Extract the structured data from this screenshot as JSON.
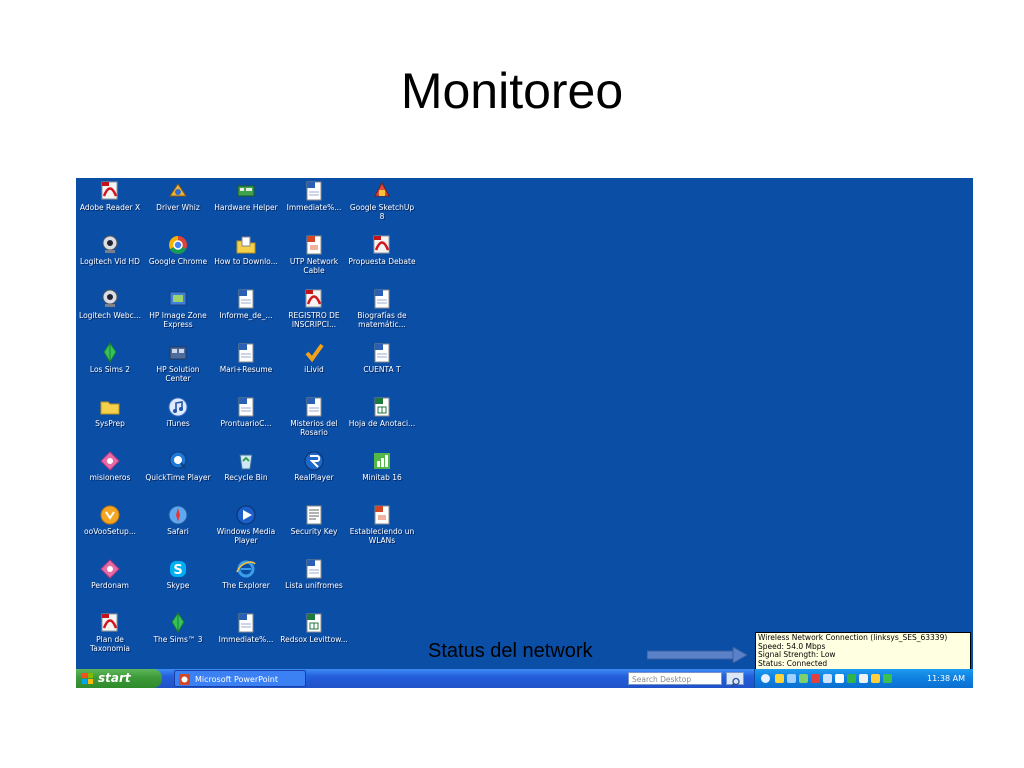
{
  "slide": {
    "title": "Monitoreo"
  },
  "desktop": {
    "background_color": "#0b4ea6",
    "columns": [
      [
        {
          "label": "Adobe Reader X",
          "icon": "pdf-icon"
        },
        {
          "label": "Logitech Vid HD",
          "icon": "webcam-icon"
        },
        {
          "label": "Logitech Webc...",
          "icon": "webcam-icon"
        },
        {
          "label": "Los Sims 2",
          "icon": "plumbob-icon"
        },
        {
          "label": "SysPrep",
          "icon": "folder-icon"
        },
        {
          "label": "misioneros",
          "icon": "network-star-icon"
        },
        {
          "label": "ooVooSetup...",
          "icon": "oovoo-icon"
        },
        {
          "label": "Perdonam",
          "icon": "network-star-icon"
        },
        {
          "label": "Plan de Taxonomia",
          "icon": "pdf-icon"
        }
      ],
      [
        {
          "label": "Driver Whiz",
          "icon": "driver-icon"
        },
        {
          "label": "Google Chrome",
          "icon": "chrome-icon"
        },
        {
          "label": "HP Image Zone Express",
          "icon": "hp-image-icon"
        },
        {
          "label": "HP Solution Center",
          "icon": "hp-solution-icon"
        },
        {
          "label": "iTunes",
          "icon": "music-icon"
        },
        {
          "label": "QuickTime Player",
          "icon": "quicktime-icon"
        },
        {
          "label": "Safari",
          "icon": "compass-icon"
        },
        {
          "label": "Skype",
          "icon": "skype-icon"
        },
        {
          "label": "The Sims™ 3",
          "icon": "plumbob-icon"
        }
      ],
      [
        {
          "label": "Hardware Helper",
          "icon": "hardware-icon"
        },
        {
          "label": "How to Downlo...",
          "icon": "folder-doc-icon"
        },
        {
          "label": "Informe_de_...",
          "icon": "word-doc-icon"
        },
        {
          "label": "Mari+Resume",
          "icon": "word-doc-icon"
        },
        {
          "label": "ProntuarioC...",
          "icon": "word-doc-icon"
        },
        {
          "label": "Recycle Bin",
          "icon": "recycle-bin-icon"
        },
        {
          "label": "Windows Media Player",
          "icon": "media-player-icon"
        },
        {
          "label": "The Explorer",
          "icon": "ie-icon"
        },
        {
          "label": "Immediate%...",
          "icon": "word-doc-icon"
        }
      ],
      [
        {
          "label": "Immediate%...",
          "icon": "word-doc-icon"
        },
        {
          "label": "UTP Network Cable",
          "icon": "ppt-doc-icon"
        },
        {
          "label": "REGISTRO DE INSCRIPCI...",
          "icon": "pdf-icon"
        },
        {
          "label": "iLivid",
          "icon": "ilivid-icon"
        },
        {
          "label": "Misterios del Rosario",
          "icon": "word-doc-icon"
        },
        {
          "label": "RealPlayer",
          "icon": "realplayer-icon"
        },
        {
          "label": "Security Key",
          "icon": "text-doc-icon"
        },
        {
          "label": "Lista unifromes",
          "icon": "word-doc-icon"
        },
        {
          "label": "Redsox Levittow...",
          "icon": "excel-doc-icon"
        }
      ],
      [
        {
          "label": "Google SketchUp 8",
          "icon": "sketchup-icon"
        },
        {
          "label": "Propuesta Debate",
          "icon": "pdf-icon"
        },
        {
          "label": "Biografías de matemátic...",
          "icon": "word-doc-icon"
        },
        {
          "label": "CUENTA T",
          "icon": "word-doc-icon"
        },
        {
          "label": "Hoja de Anotaci...",
          "icon": "excel-doc-icon"
        },
        {
          "label": "Minitab 16",
          "icon": "minitab-icon"
        },
        {
          "label": "Estableciendo un WLANs",
          "icon": "ppt-doc-icon"
        }
      ]
    ]
  },
  "annotation": {
    "text": "Status del network",
    "arrow_icon": "right-arrow-icon"
  },
  "tooltip": {
    "lines": [
      "Wireless Network Connection (linksys_SES_63339)",
      "Speed: 54.0 Mbps",
      "Signal Strength: Low",
      "Status: Connected"
    ]
  },
  "taskbar": {
    "start_label": "start",
    "task_item_label": "Microsoft PowerPoint",
    "search_placeholder": "Search Desktop",
    "clock": "11:38 AM",
    "colors": {
      "taskbar": "#245edb",
      "start": "#3c9a38",
      "tray": "#0f7fe0"
    }
  }
}
